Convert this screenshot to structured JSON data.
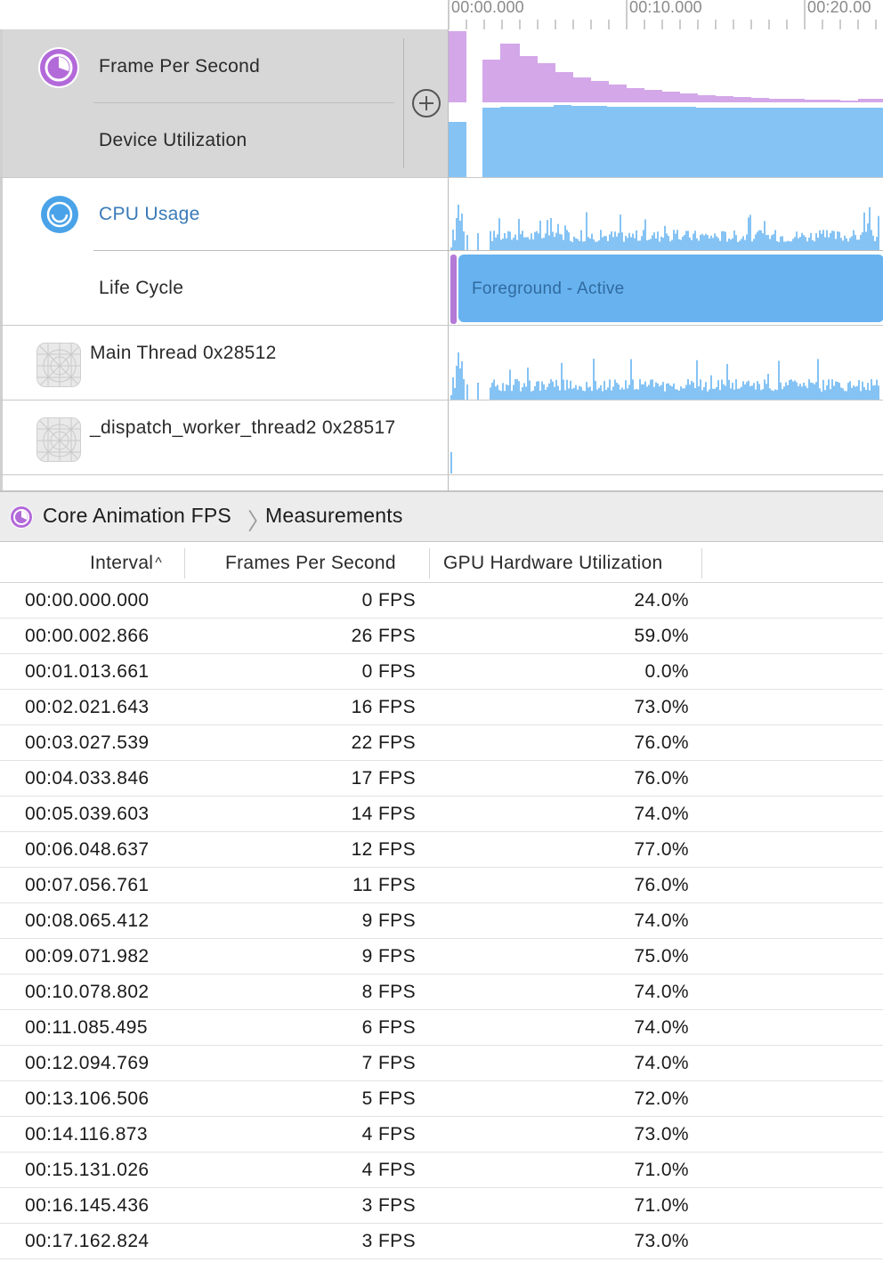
{
  "colors": {
    "fps_purple": "#d3a7e8",
    "fps_icon_purple": "#b36ad9",
    "util_blue": "#85c3f4",
    "cpu_icon_blue": "#4aa3e8",
    "lifecycle_blue": "#68b3ef",
    "lifecycle_mark_purple": "#b47ad8"
  },
  "ruler": {
    "labels": [
      "00:00.000",
      "00:10.000",
      "00:20.00"
    ]
  },
  "tracks": {
    "fps": {
      "icon": "core-animation-icon",
      "label_primary": "Frame Per Second",
      "label_secondary": "Device Utilization",
      "add_icon": "plus-circle-icon"
    },
    "cpu": {
      "icon": "activity-monitor-icon",
      "label_primary": "CPU Usage",
      "label_secondary": "Life Cycle",
      "lifecycle_state": "Foreground - Active"
    },
    "main_thread": {
      "icon": "thread-icon",
      "label": "Main Thread  0x28512"
    },
    "dispatch_thread": {
      "icon": "thread-icon",
      "label": "_dispatch_worker_thread2  0x28517"
    }
  },
  "detail": {
    "breadcrumb": {
      "icon": "core-animation-icon",
      "instrument": "Core Animation FPS",
      "separator_icon": "chevron-right-icon",
      "view": "Measurements"
    },
    "columns": {
      "interval": "Interval",
      "fps": "Frames Per Second",
      "gpu": "GPU Hardware Utilization",
      "sort_icon": "sort-ascending-icon"
    },
    "rows": [
      {
        "interval": "00:00.000.000",
        "fps": "0 FPS",
        "gpu": "24.0%"
      },
      {
        "interval": "00:00.002.866",
        "fps": "26 FPS",
        "gpu": "59.0%"
      },
      {
        "interval": "00:01.013.661",
        "fps": "0 FPS",
        "gpu": "0.0%"
      },
      {
        "interval": "00:02.021.643",
        "fps": "16 FPS",
        "gpu": "73.0%"
      },
      {
        "interval": "00:03.027.539",
        "fps": "22 FPS",
        "gpu": "76.0%"
      },
      {
        "interval": "00:04.033.846",
        "fps": "17 FPS",
        "gpu": "76.0%"
      },
      {
        "interval": "00:05.039.603",
        "fps": "14 FPS",
        "gpu": "74.0%"
      },
      {
        "interval": "00:06.048.637",
        "fps": "12 FPS",
        "gpu": "77.0%"
      },
      {
        "interval": "00:07.056.761",
        "fps": "11 FPS",
        "gpu": "76.0%"
      },
      {
        "interval": "00:08.065.412",
        "fps": "9 FPS",
        "gpu": "74.0%"
      },
      {
        "interval": "00:09.071.982",
        "fps": "9 FPS",
        "gpu": "75.0%"
      },
      {
        "interval": "00:10.078.802",
        "fps": "8 FPS",
        "gpu": "74.0%"
      },
      {
        "interval": "00:11.085.495",
        "fps": "6 FPS",
        "gpu": "74.0%"
      },
      {
        "interval": "00:12.094.769",
        "fps": "7 FPS",
        "gpu": "74.0%"
      },
      {
        "interval": "00:13.106.506",
        "fps": "5 FPS",
        "gpu": "72.0%"
      },
      {
        "interval": "00:14.116.873",
        "fps": "4 FPS",
        "gpu": "73.0%"
      },
      {
        "interval": "00:15.131.026",
        "fps": "4 FPS",
        "gpu": "71.0%"
      },
      {
        "interval": "00:16.145.436",
        "fps": "3 FPS",
        "gpu": "71.0%"
      },
      {
        "interval": "00:17.162.824",
        "fps": "3 FPS",
        "gpu": "73.0%"
      }
    ]
  }
}
